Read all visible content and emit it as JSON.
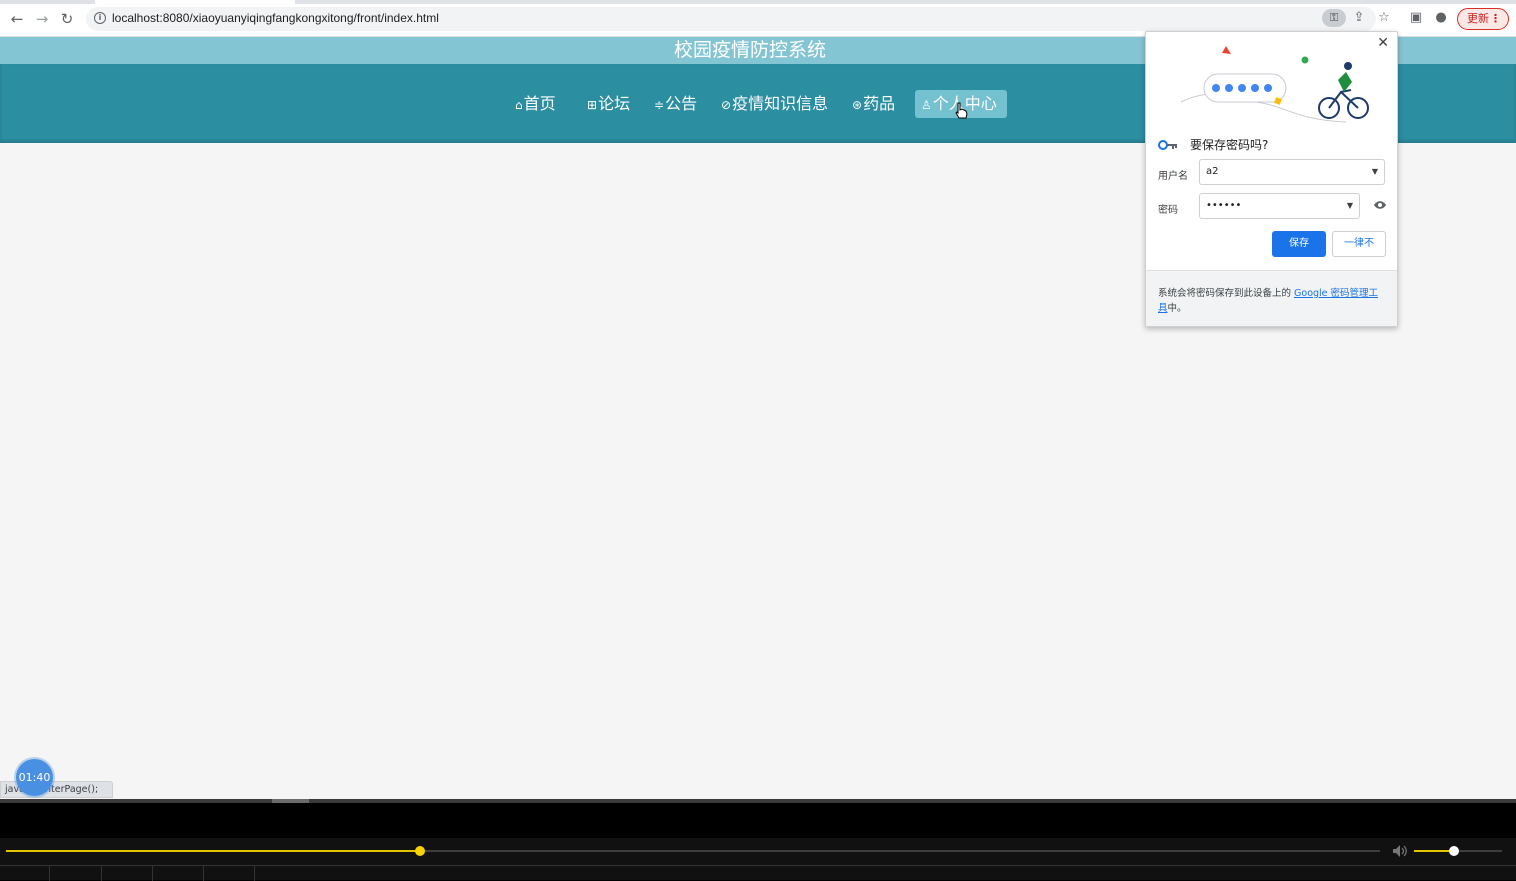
{
  "browser": {
    "url": "localhost:8080/xiaoyuanyiqingfangkongxitong/front/index.html",
    "update_label": "更新",
    "status_text": "java...centerPage();"
  },
  "site": {
    "title": "校园疫情防控系统",
    "nav": [
      {
        "icon": "⌂",
        "label": "首页"
      },
      {
        "icon": "⊞",
        "label": "论坛"
      },
      {
        "icon": "≑",
        "label": "公告"
      },
      {
        "icon": "⊘",
        "label": "疫情知识信息"
      },
      {
        "icon": "⊛",
        "label": "药品"
      },
      {
        "icon": "♙",
        "label": "个人中心"
      }
    ],
    "active_nav": "个人中心"
  },
  "password_dialog": {
    "title": "要保存密码吗?",
    "username_label": "用户名",
    "username_value": "a2",
    "password_label": "密码",
    "password_value": "••••••",
    "save_label": "保存",
    "never_label": "一律不",
    "footer_text": "系统会将密码保存到此设备上的 ",
    "footer_link": "Google 密码管理工具",
    "footer_end": "中。"
  },
  "player": {
    "timer": "01:40",
    "progress_fraction": 0.301,
    "volume_fraction": 0.45
  },
  "colors": {
    "nav_bg": "#2b8ea1",
    "title_bg": "#84c5d3",
    "active_nav_bg": "#74c1d0",
    "accent_blue": "#1a73e8",
    "progress": "#e6c500"
  }
}
